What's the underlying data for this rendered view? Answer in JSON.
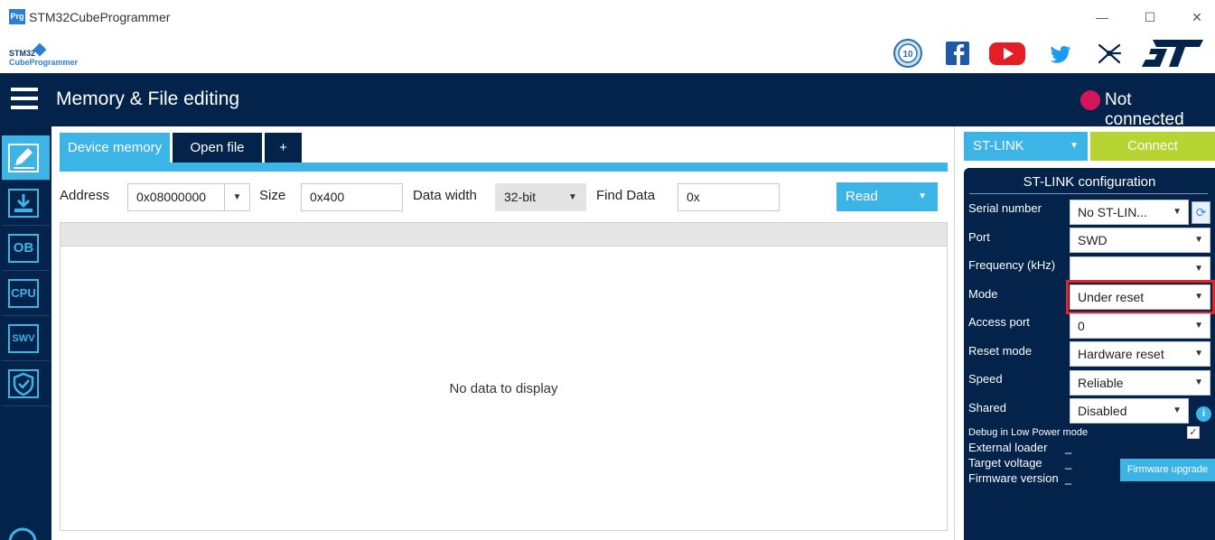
{
  "window": {
    "app_icon": "Prg",
    "title": "STM32CubeProgrammer",
    "minimize": "—",
    "maximize": "☐",
    "close": "✕"
  },
  "brand": {
    "logo_line1": "STM32",
    "logo_line2": "CubeProgrammer",
    "social_icons": [
      "anniversary-10-icon",
      "facebook-icon",
      "youtube-icon",
      "twitter-icon",
      "network-icon",
      "st-logo"
    ]
  },
  "header": {
    "title": "Memory & File editing",
    "connection_status": "Not connected",
    "status_color": "#d6145b"
  },
  "sidebar": {
    "items": [
      "edit-icon",
      "download-icon",
      "OB",
      "CPU",
      "SWV",
      "security-shield-icon"
    ]
  },
  "tabs": [
    {
      "label": "Device memory",
      "active": true
    },
    {
      "label": "Open file",
      "active": false
    },
    {
      "label": "+",
      "active": false
    }
  ],
  "toolbar": {
    "address_label": "Address",
    "address_value": "0x08000000",
    "size_label": "Size",
    "size_value": "0x400",
    "width_label": "Data width",
    "width_value": "32-bit",
    "find_label": "Find Data",
    "find_value": "0x",
    "read_label": "Read"
  },
  "data_area": {
    "empty_message": "No data to display"
  },
  "right_panel": {
    "interface": "ST-LINK",
    "connect_label": "Connect",
    "config_title": "ST-LINK configuration",
    "fields": [
      {
        "label": "Serial number",
        "value": "No ST-LIN..."
      },
      {
        "label": "Port",
        "value": "SWD"
      },
      {
        "label": "Frequency (kHz)",
        "value": ""
      },
      {
        "label": "Mode",
        "value": "Under reset"
      },
      {
        "label": "Access port",
        "value": "0"
      },
      {
        "label": "Reset mode",
        "value": "Hardware reset"
      },
      {
        "label": "Speed",
        "value": "Reliable"
      },
      {
        "label": "Shared",
        "value": "Disabled"
      }
    ],
    "low_power_label": "Debug in Low Power mode",
    "low_power_checked": true,
    "external_loader_label": "External loader",
    "external_loader_value": "_",
    "target_voltage_label": "Target voltage",
    "target_voltage_value": "_",
    "firmware_version_label": "Firmware version",
    "firmware_version_value": "_",
    "firmware_upgrade_label": "Firmware upgrade",
    "highlight_color": "#e3252b"
  },
  "colors": {
    "navy": "#03234b",
    "accent": "#3cb4e6",
    "connect": "#b7d433"
  }
}
